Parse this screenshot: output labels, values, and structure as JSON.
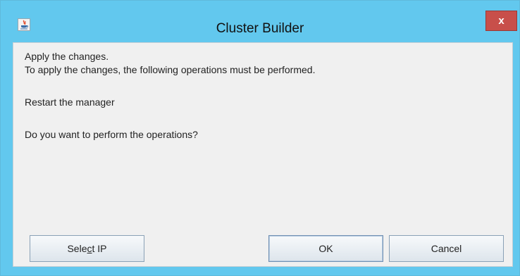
{
  "window": {
    "title": "Cluster Builder",
    "close_label": "x"
  },
  "dialog": {
    "line1": "Apply the changes.",
    "line2": "To apply the changes, the following operations must be performed.",
    "operation": "Restart the manager",
    "question": "Do you want to perform the operations?"
  },
  "buttons": {
    "select_ip_prefix": "Sele",
    "select_ip_mnemonic": "c",
    "select_ip_suffix": "t IP",
    "ok": "OK",
    "cancel": "Cancel"
  },
  "icons": {
    "app": "java-app-icon",
    "close": "close-icon"
  },
  "colors": {
    "titlebar": "#62c8ee",
    "close_button": "#c84f4a",
    "panel": "#f0f0f0"
  }
}
